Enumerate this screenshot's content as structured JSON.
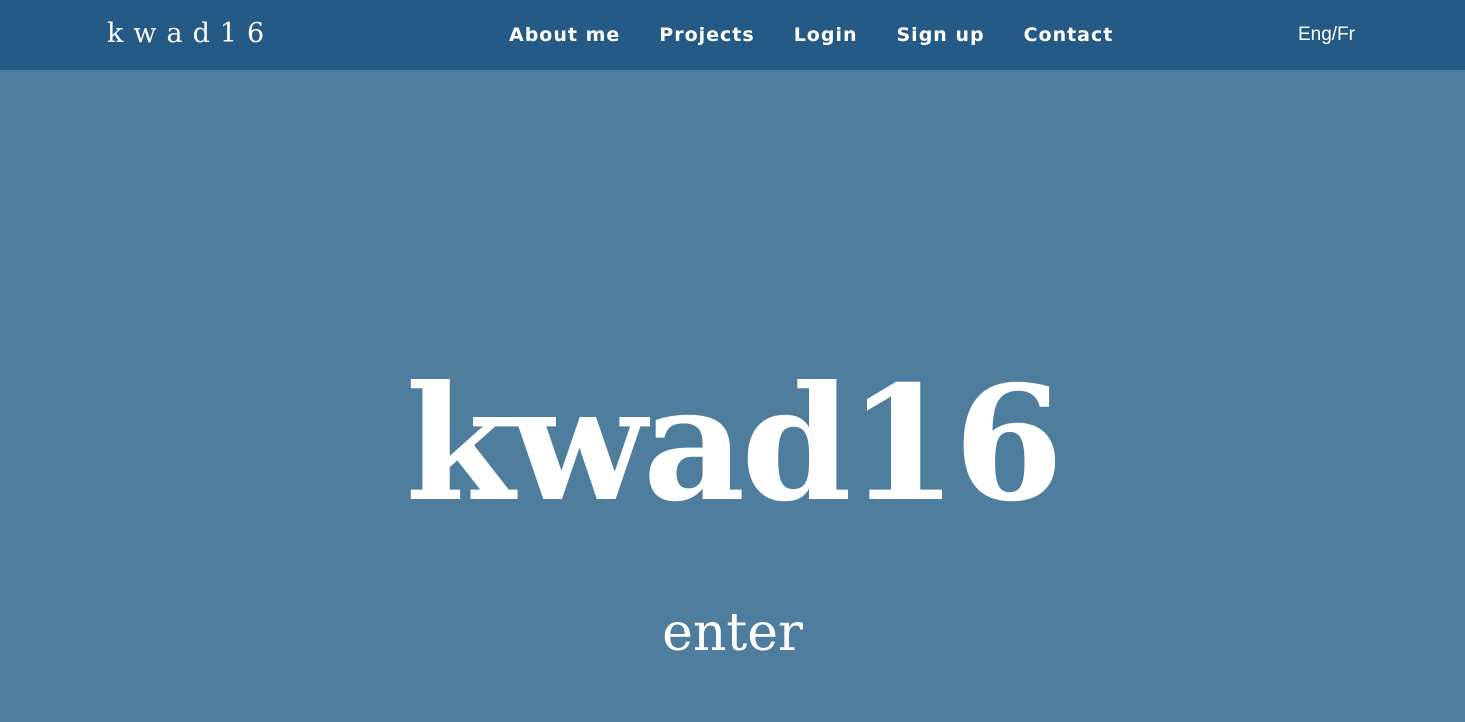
{
  "navbar": {
    "brand": "kwad16",
    "links": [
      {
        "label": "About me"
      },
      {
        "label": "Projects"
      },
      {
        "label": "Login"
      },
      {
        "label": "Sign up"
      },
      {
        "label": "Contact"
      }
    ],
    "language_toggle": "Eng/Fr",
    "background_color": "#245a85"
  },
  "hero": {
    "title": "kwad16",
    "enter_label": "enter",
    "background_color": "#4f7d9e"
  }
}
